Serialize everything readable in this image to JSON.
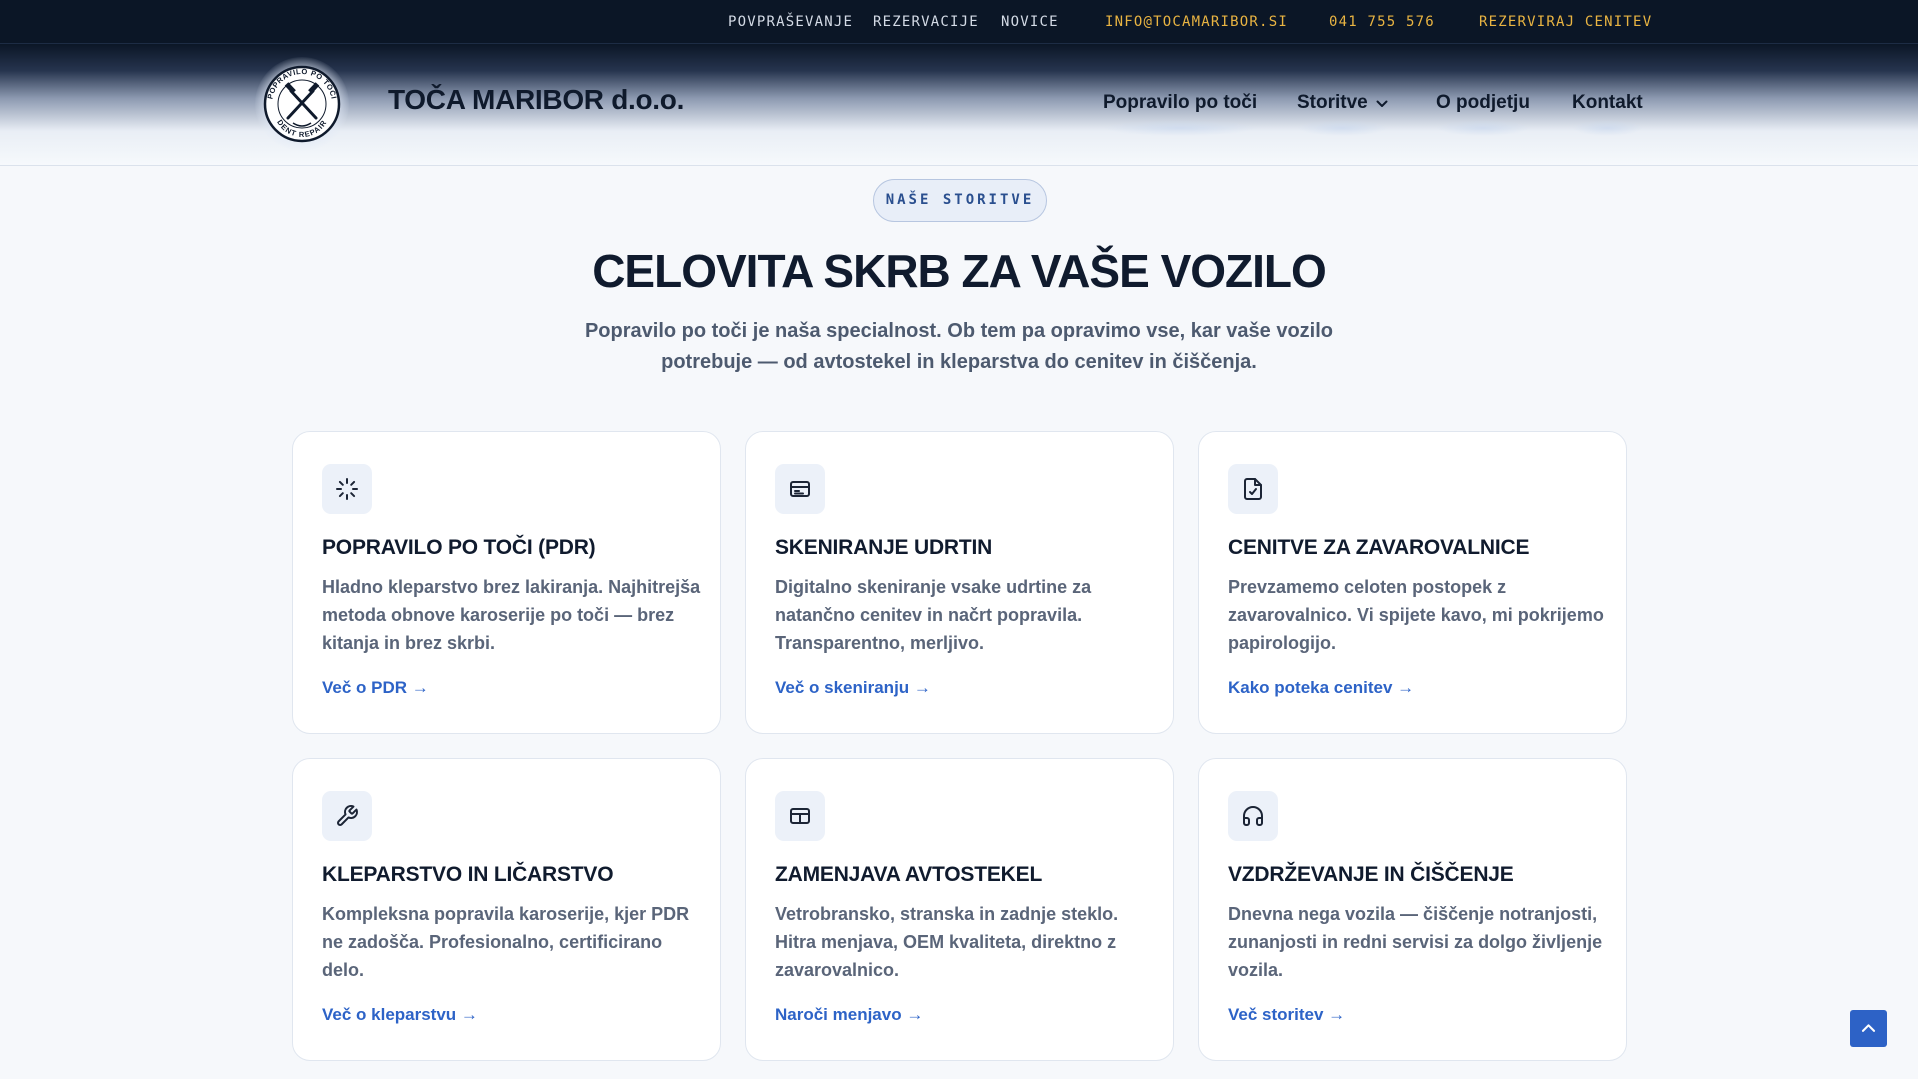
{
  "topbar": {
    "nav": [
      "POVPRAŠEVANJE",
      "REZERVACIJE",
      "NOVICE"
    ],
    "email": "INFO@TOCAMARIBOR.SI",
    "phone": "041 755 576",
    "cta": "REZERVIRAJ CENITEV",
    "accent_color": "#e9b442"
  },
  "header": {
    "logo_text_top": "POPRAVILO PO TOČI",
    "logo_text_bottom": "DENT REPAIR",
    "brand": "TOČA MARIBOR d.o.o.",
    "nav": [
      {
        "label": "Popravilo po toči",
        "icon": ""
      },
      {
        "label": "Storitve",
        "icon": "chevron-down-icon"
      },
      {
        "label": "O podjetju",
        "icon": ""
      },
      {
        "label": "Kontakt",
        "icon": ""
      }
    ]
  },
  "section": {
    "eyebrow": "NAŠE STORITVE",
    "title": "CELOVITA SKRB ZA VAŠE VOZILO",
    "lead": "Popravilo po toči je naša specialnost. Ob tem pa opravimo vse, kar vaše vozilo potrebuje — od avtostekel in kleparstva do cenitev in čiščenja."
  },
  "services": [
    {
      "icon": "loader-icon",
      "title": "POPRAVILO PO TOČI (PDR)",
      "desc": "Hladno kleparstvo brez lakiranja. Najhitrejša metoda obnove karoserije po toči — brez kitanja in brez skrbi.",
      "link": "Več o PDR →"
    },
    {
      "icon": "scanner-card-icon",
      "title": "SKENIRANJE UDRTIN",
      "desc": "Digitalno skeniranje vsake udrtine za natančno cenitev in načrt popravila. Transparentno, merljivo.",
      "link": "Več o skeniranju →"
    },
    {
      "icon": "file-check-icon",
      "title": "CENITVE ZA ZAVAROVALNICE",
      "desc": "Prevzamemo celoten postopek z zavarovalnico. Vi spijete kavo, mi pokrijemo papirologijo.",
      "link": "Kako poteka cenitev →"
    },
    {
      "icon": "wrench-icon",
      "title": "KLEPARSTVO IN LIČARSTVO",
      "desc": "Kompleksna popravila karoserije, kjer PDR ne zadošča. Profesionalno, certificirano delo.",
      "link": "Več o kleparstvu →"
    },
    {
      "icon": "window-pane-icon",
      "title": "ZAMENJAVA AVTOSTEKEL",
      "desc": "Vetrobransko, stranska in zadnje steklo. Hitra menjava, OEM kvaliteta, direktno z zavarovalnico.",
      "link": "Naroči menjavo →"
    },
    {
      "icon": "headphones-icon",
      "title": "VZDRŽEVANJE IN ČIŠČENJE",
      "desc": "Dnevna nega vozila — čiščenje notranjosti, zunanjosti in redni servisi za dolgo življenje vozila.",
      "link": "Več storitev →"
    }
  ],
  "back_to_top_icon": "chevron-up-icon",
  "link_color": "#2d63c7"
}
